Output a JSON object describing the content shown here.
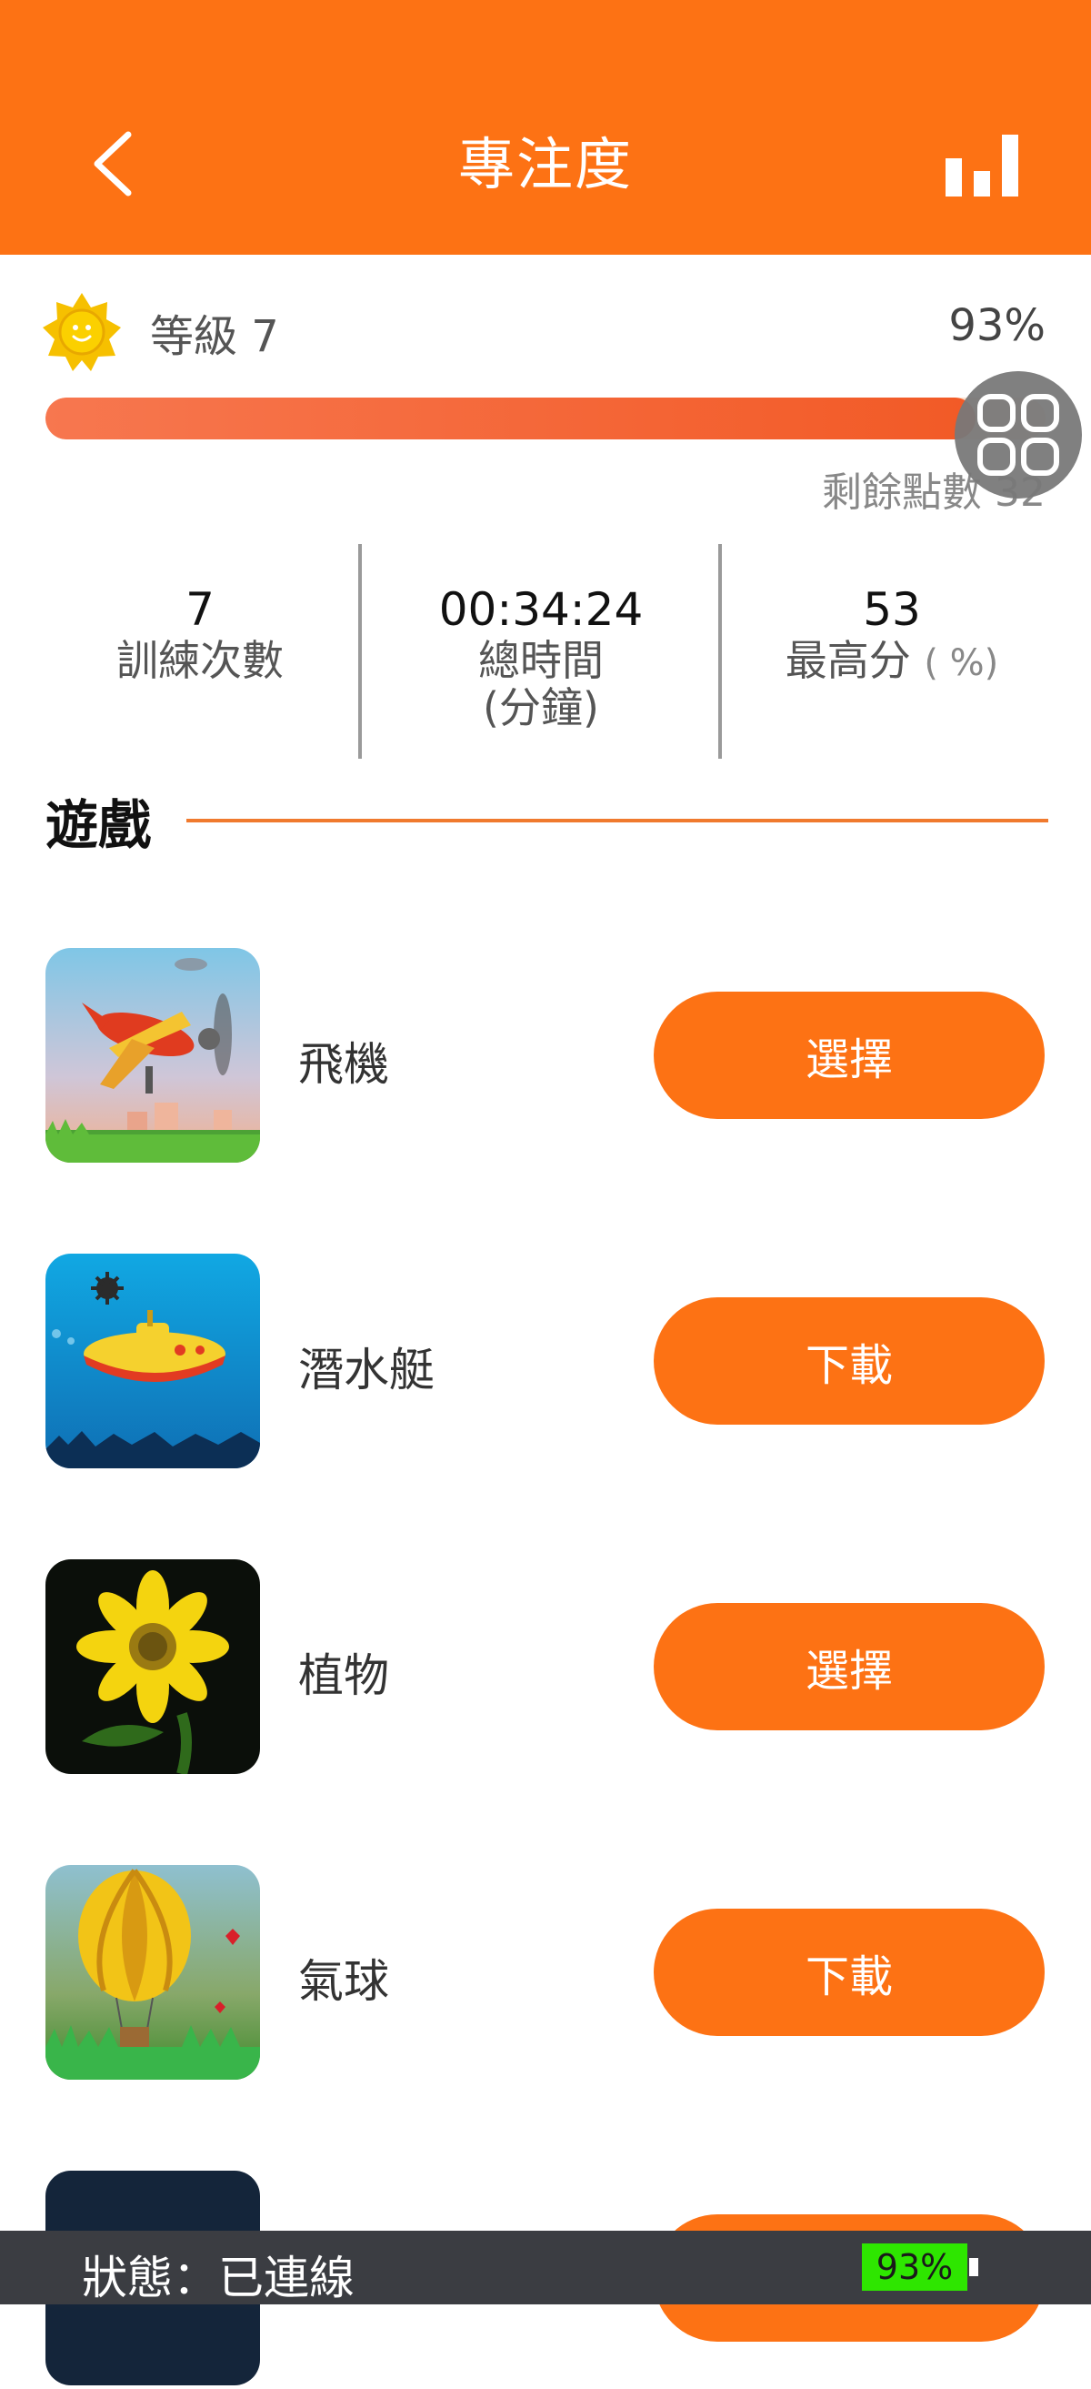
{
  "header": {
    "title": "專注度"
  },
  "level": {
    "label": "等級 7",
    "percent_text": "93%",
    "progress": 0.93,
    "points_text": "剩餘點數 32"
  },
  "stats": [
    {
      "value": "7",
      "label": "訓練次數"
    },
    {
      "value": "00:34:24",
      "label": "總時間",
      "label2": "(分鐘)"
    },
    {
      "value": "53",
      "label": "最高分",
      "unit": "( %)"
    }
  ],
  "section": {
    "title": "遊戲"
  },
  "games": [
    {
      "name": "飛機",
      "action": "選擇",
      "icon": "airplane-thumbnail"
    },
    {
      "name": "潛水艇",
      "action": "下載",
      "icon": "submarine-thumbnail"
    },
    {
      "name": "植物",
      "action": "選擇",
      "icon": "sunflower-thumbnail"
    },
    {
      "name": "氣球",
      "action": "下載",
      "icon": "balloon-thumbnail"
    }
  ],
  "status": {
    "text": "狀態：已連線",
    "battery": "93%"
  },
  "colors": {
    "accent": "#fd7214",
    "status_bg": "#3b3d42",
    "battery_green": "#2ee600"
  }
}
